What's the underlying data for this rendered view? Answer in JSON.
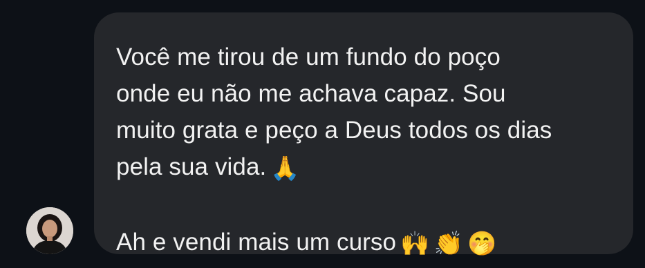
{
  "message": {
    "lines": [
      "Você me tirou de um fundo do poço",
      "onde eu não me achava capaz. Sou",
      "muito grata e peço a Deus todos os dias",
      "pela sua vida."
    ],
    "line_4_emoji": "🙏",
    "second_paragraph": "Ah e vendi mais um curso",
    "second_emojis": [
      "🙌",
      "👏",
      "🤭"
    ]
  },
  "colors": {
    "background": "#0d1117",
    "bubble": "#25272b",
    "text": "#f2f2f2"
  },
  "icons": {
    "avatar": "sender-avatar"
  }
}
